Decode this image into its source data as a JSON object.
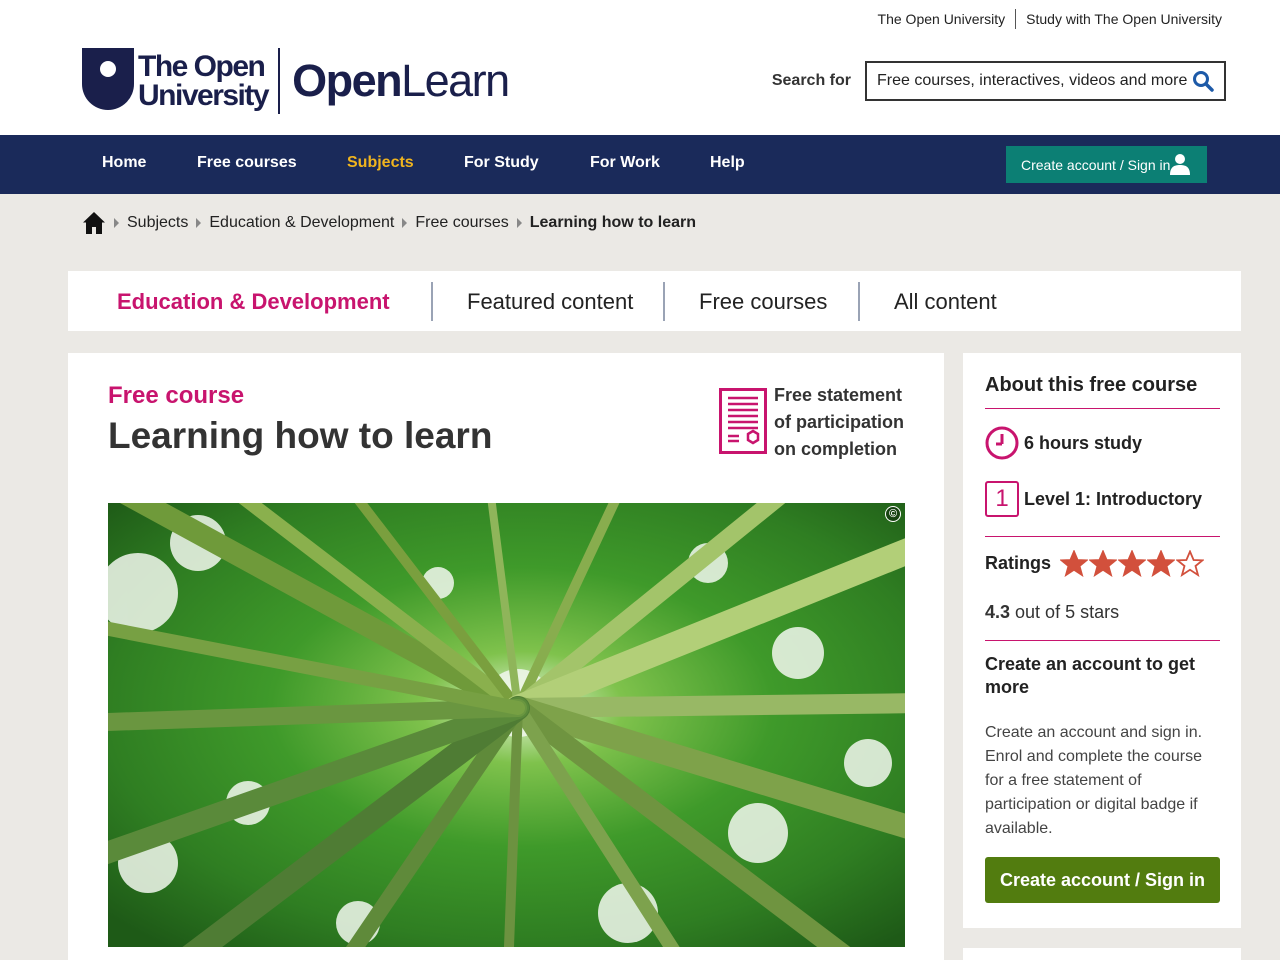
{
  "header": {
    "top_links": [
      "The Open University",
      "Study with The Open University"
    ],
    "logo": {
      "ou_line1": "The Open",
      "ou_line2": "University",
      "brand_bold": "Open",
      "brand_light": "Learn"
    },
    "search": {
      "label": "Search for",
      "placeholder": "Free courses, interactives, videos and more"
    }
  },
  "nav": {
    "items": [
      "Home",
      "Free courses",
      "Subjects",
      "For Study",
      "For Work",
      "Help"
    ],
    "active": "Subjects",
    "signin_label": "Create account / Sign in"
  },
  "breadcrumb": {
    "items": [
      "Subjects",
      "Education & Development",
      "Free courses"
    ],
    "current": "Learning how to learn"
  },
  "subject_tabs": {
    "title": "Education & Development",
    "tabs": [
      "Featured content",
      "Free courses",
      "All content"
    ]
  },
  "course": {
    "label": "Free course",
    "title": "Learning how to learn",
    "statement_lines": [
      "Free statement",
      "of participation",
      "on completion"
    ],
    "copyright_symbol": "©"
  },
  "sidebar": {
    "title": "About this free course",
    "study_hours": "6 hours study",
    "level_number": "1",
    "level_text": "Level 1: Introductory",
    "ratings_label": "Ratings",
    "rating_value": 4.3,
    "rating_max": 5,
    "rating_value_text": "4.3",
    "rating_suffix": " out of 5 stars",
    "account_heading": "Create an account to get more",
    "account_body": "Create an account and sign in. Enrol and complete the course for a free statement of participation or digital badge if available.",
    "account_button": "Create account / Sign in"
  },
  "colors": {
    "navy": "#1a2a5a",
    "magenta": "#c8146e",
    "teal": "#0c7f74",
    "green_button": "#527c0f",
    "star": "#d2503c",
    "nav_active": "#f0b41e"
  }
}
